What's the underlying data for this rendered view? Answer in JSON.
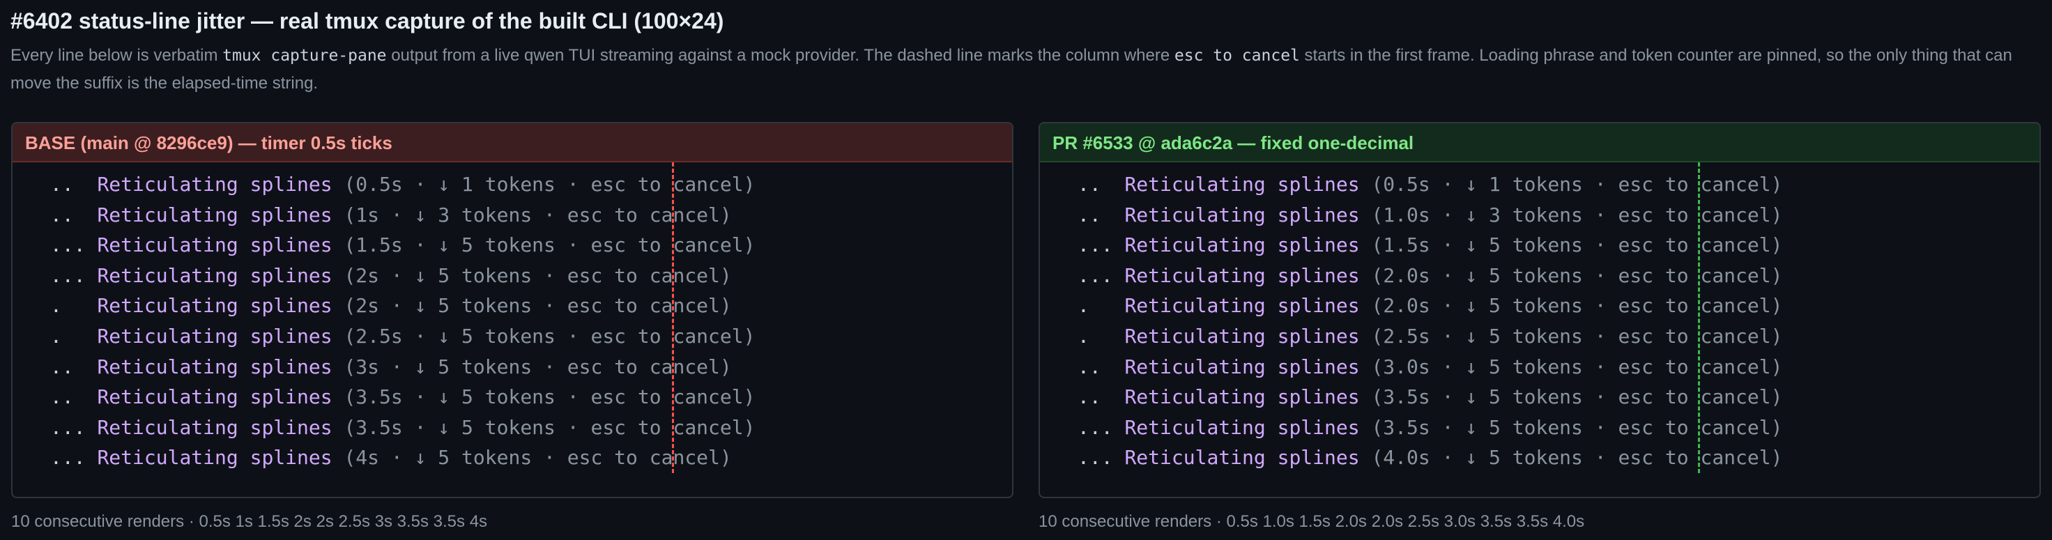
{
  "page": {
    "title": "#6402 status-line jitter — real tmux capture of the built CLI (100×24)",
    "subtitle_parts": [
      "Every line below is verbatim ",
      "tmux capture-pane",
      " output from a live qwen TUI streaming against a mock provider. The dashed line marks the column where ",
      "esc to cancel",
      " starts in the first frame. Loading phrase and token counter are pinned, so the only thing that can move the suffix is the elapsed-time string."
    ]
  },
  "colors": {
    "background": "#0d1117",
    "base_accent": "#ffa198",
    "base_marker": "#f85149",
    "pr_accent": "#7ee787",
    "pr_marker": "#3fb950",
    "phrase": "#d2a8ff",
    "muted": "#8b949e"
  },
  "panels": {
    "base": {
      "header": "BASE (main @ 8296ce9) — timer 0.5s ticks",
      "lines": [
        {
          "dots": "..  ",
          "phrase": "Reticulating splines",
          "status": " (0.5s · ↓ 1 tokens · esc to cancel)"
        },
        {
          "dots": "..  ",
          "phrase": "Reticulating splines",
          "status": " (1s · ↓ 3 tokens · esc to cancel)"
        },
        {
          "dots": "... ",
          "phrase": "Reticulating splines",
          "status": " (1.5s · ↓ 5 tokens · esc to cancel)"
        },
        {
          "dots": "... ",
          "phrase": "Reticulating splines",
          "status": " (2s · ↓ 5 tokens · esc to cancel)"
        },
        {
          "dots": ".   ",
          "phrase": "Reticulating splines",
          "status": " (2s · ↓ 5 tokens · esc to cancel)"
        },
        {
          "dots": ".   ",
          "phrase": "Reticulating splines",
          "status": " (2.5s · ↓ 5 tokens · esc to cancel)"
        },
        {
          "dots": "..  ",
          "phrase": "Reticulating splines",
          "status": " (3s · ↓ 5 tokens · esc to cancel)"
        },
        {
          "dots": "..  ",
          "phrase": "Reticulating splines",
          "status": " (3.5s · ↓ 5 tokens · esc to cancel)"
        },
        {
          "dots": "... ",
          "phrase": "Reticulating splines",
          "status": " (3.5s · ↓ 5 tokens · esc to cancel)"
        },
        {
          "dots": "... ",
          "phrase": "Reticulating splines",
          "status": " (4s · ↓ 5 tokens · esc to cancel)"
        }
      ],
      "footer": "10 consecutive renders · 0.5s 1s 1.5s 2s 2s 2.5s 3s 3.5s 3.5s 4s"
    },
    "pr": {
      "header": "PR #6533 @ ada6c2a — fixed one-decimal",
      "lines": [
        {
          "dots": "..  ",
          "phrase": "Reticulating splines",
          "status": " (0.5s · ↓ 1 tokens · esc to cancel)"
        },
        {
          "dots": "..  ",
          "phrase": "Reticulating splines",
          "status": " (1.0s · ↓ 3 tokens · esc to cancel)"
        },
        {
          "dots": "... ",
          "phrase": "Reticulating splines",
          "status": " (1.5s · ↓ 5 tokens · esc to cancel)"
        },
        {
          "dots": "... ",
          "phrase": "Reticulating splines",
          "status": " (2.0s · ↓ 5 tokens · esc to cancel)"
        },
        {
          "dots": ".   ",
          "phrase": "Reticulating splines",
          "status": " (2.0s · ↓ 5 tokens · esc to cancel)"
        },
        {
          "dots": ".   ",
          "phrase": "Reticulating splines",
          "status": " (2.5s · ↓ 5 tokens · esc to cancel)"
        },
        {
          "dots": "..  ",
          "phrase": "Reticulating splines",
          "status": " (3.0s · ↓ 5 tokens · esc to cancel)"
        },
        {
          "dots": "..  ",
          "phrase": "Reticulating splines",
          "status": " (3.5s · ↓ 5 tokens · esc to cancel)"
        },
        {
          "dots": "... ",
          "phrase": "Reticulating splines",
          "status": " (3.5s · ↓ 5 tokens · esc to cancel)"
        },
        {
          "dots": "... ",
          "phrase": "Reticulating splines",
          "status": " (4.0s · ↓ 5 tokens · esc to cancel)"
        }
      ],
      "footer": "10 consecutive renders · 0.5s 1.0s 1.5s 2.0s 2.0s 2.5s 3.0s 3.5s 3.5s 4.0s"
    }
  }
}
